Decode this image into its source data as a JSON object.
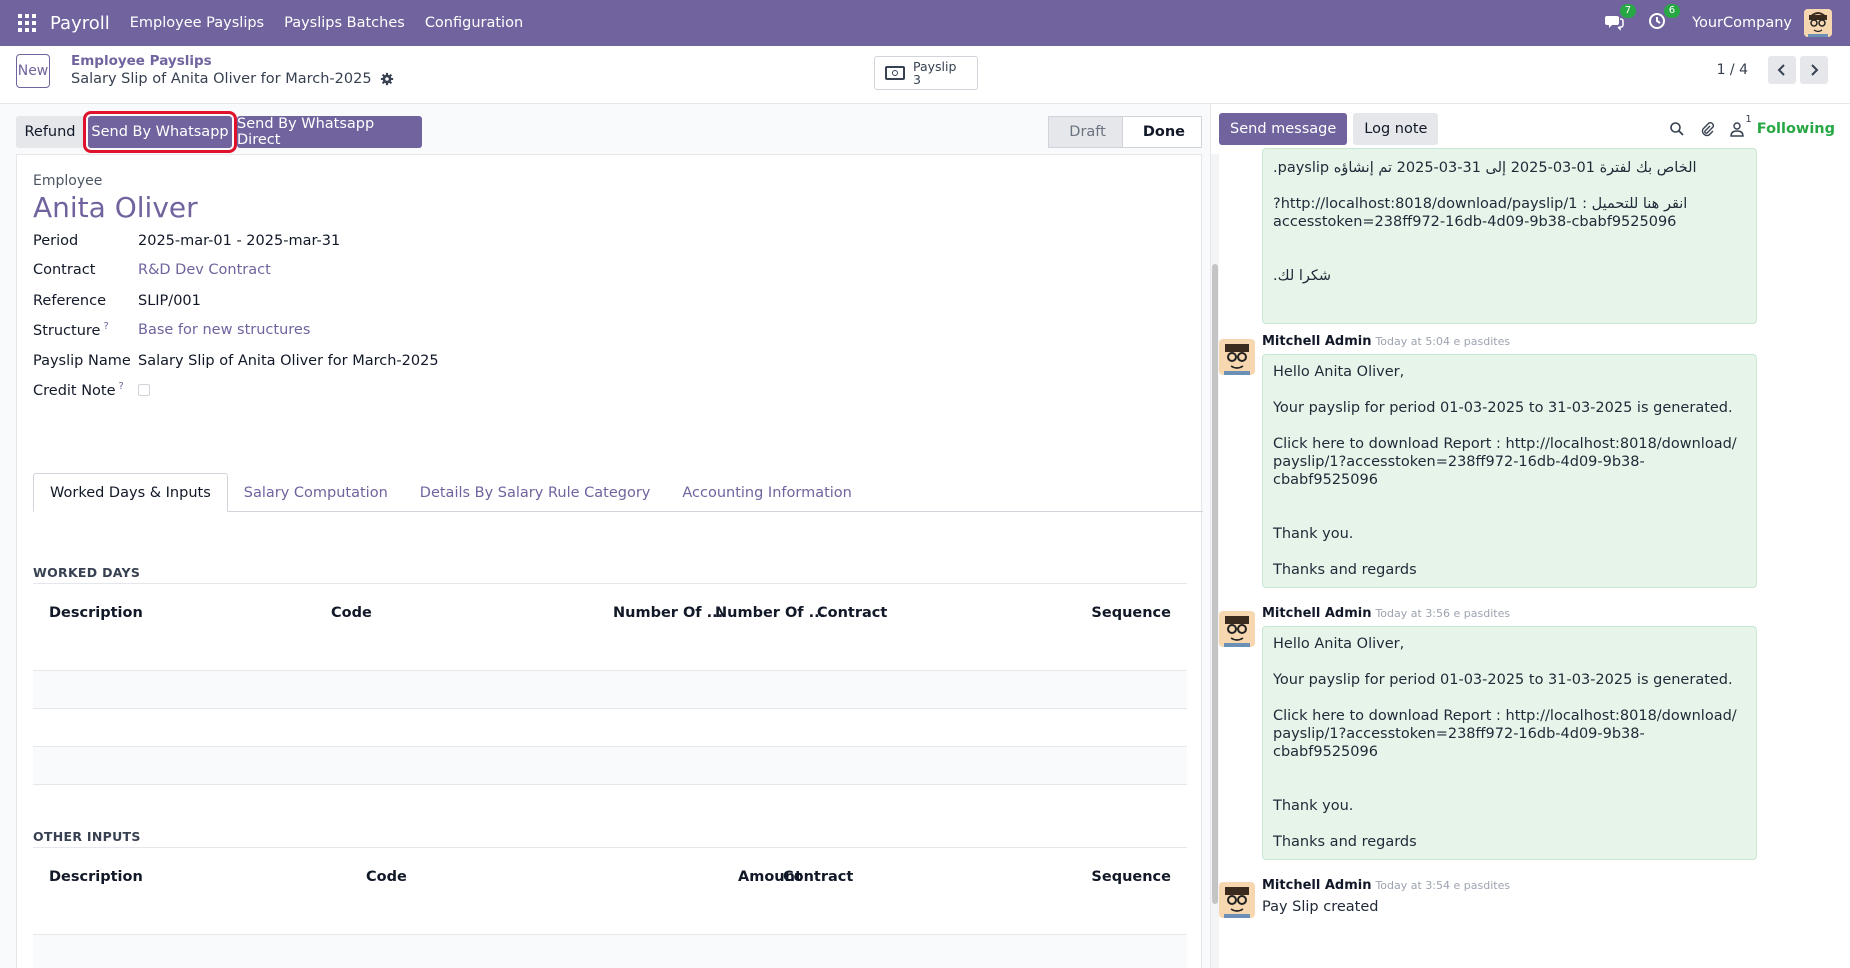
{
  "navbar": {
    "app": "Payroll",
    "menu": [
      "Employee Payslips",
      "Payslips Batches",
      "Configuration"
    ],
    "messages_badge": "7",
    "activities_badge": "6",
    "company": "YourCompany",
    "brand_color": "#71639e"
  },
  "control": {
    "new_label": "New",
    "breadcrumb_parent": "Employee Payslips",
    "breadcrumb_current": "Salary Slip of Anita Oliver for March-2025",
    "smart_label": "Payslip",
    "smart_count": "3",
    "pager": "1 / 4"
  },
  "header": {
    "refund": "Refund",
    "send_whatsapp": "Send By Whatsapp",
    "send_whatsapp_direct": "Send By Whatsapp Direct",
    "states": [
      "Draft",
      "Done"
    ],
    "active_state": "Done"
  },
  "form": {
    "employee_label": "Employee",
    "employee_name": "Anita Oliver",
    "fields": [
      {
        "label": "Period",
        "value": "2025-mar-01 - 2025-mar-31"
      },
      {
        "label": "Contract",
        "value": "R&D Dev Contract"
      },
      {
        "label": "Reference",
        "value": "SLIP/001"
      },
      {
        "label": "Structure",
        "help": "?",
        "value": "Base for new structures"
      },
      {
        "label": "Payslip Name",
        "value": "Salary Slip of Anita Oliver for March-2025"
      },
      {
        "label": "Credit Note",
        "help": "?"
      }
    ],
    "tabs": [
      "Worked Days & Inputs",
      "Salary Computation",
      "Details By Salary Rule Category",
      "Accounting Information"
    ],
    "worked_days": {
      "title": "WORKED DAYS",
      "columns": [
        "Description",
        "Code",
        "Number Of ...",
        "Number Of ...",
        "Contract",
        "Sequence"
      ]
    },
    "other_inputs": {
      "title": "OTHER INPUTS",
      "columns": [
        "Description",
        "Code",
        "Amount",
        "Contract",
        "Sequence"
      ]
    }
  },
  "chatter": {
    "send_message": "Send message",
    "log_note": "Log note",
    "followers_count": "1",
    "following": "Following",
    "arabic_msg": {
      "line1": "الخاص بك لفترة 01-03-2025 إلى 31-03-2025 تم إنشاؤه payslip.",
      "line2": "انقر هنا للتحميل : http://localhost:8018/download/payslip/1?",
      "line3": "accesstoken=238ff972-16db-4d09-9b38-cbabf9525096",
      "line4": "شكرا لك."
    },
    "messages": [
      {
        "author": "Mitchell Admin",
        "time": "Today at 5:04 e pasdites",
        "lines": [
          "Hello Anita Oliver,",
          "Your payslip for period 01-03-2025 to 31-03-2025 is generated.",
          "Click here to download Report : http://localhost:8018/download/",
          "payslip/1?accesstoken=238ff972-16db-4d09-9b38-cbabf9525096",
          "Thank you.",
          "Thanks and regards"
        ]
      },
      {
        "author": "Mitchell Admin",
        "time": "Today at 3:56 e pasdites",
        "lines": [
          "Hello Anita Oliver,",
          "Your payslip for period 01-03-2025 to 31-03-2025 is generated.",
          "Click here to download Report : http://localhost:8018/download/",
          "payslip/1?accesstoken=238ff972-16db-4d09-9b38-cbabf9525096",
          "Thank you.",
          "Thanks and regards"
        ]
      },
      {
        "author": "Mitchell Admin",
        "time": "Today at 3:54 e pasdites",
        "text": "Pay Slip created"
      }
    ]
  }
}
